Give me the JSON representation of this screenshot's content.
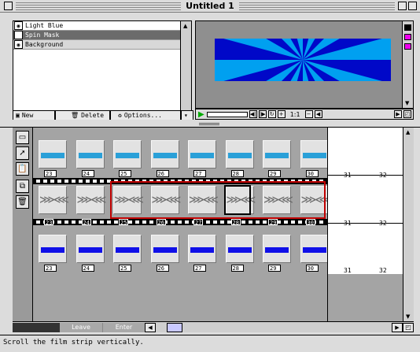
{
  "window": {
    "title": "Untitled 1"
  },
  "layers": {
    "items": [
      {
        "name": "Light Blue",
        "state": "normal"
      },
      {
        "name": "Spin Mask",
        "state": "selected"
      },
      {
        "name": "Background",
        "state": "alt"
      }
    ],
    "buttons": {
      "new": "New",
      "delete": "Delete",
      "options": "Options..."
    }
  },
  "preview": {
    "zoom": "1:1",
    "colors": {
      "bg": "#00a0f0",
      "ray": "#0008c8"
    }
  },
  "filmstrip": {
    "frame_numbers": [
      "23",
      "24",
      "25",
      "26",
      "27",
      "28",
      "29",
      "30"
    ],
    "extra_numbers": [
      "31",
      "32"
    ],
    "rows": [
      {
        "name": "light-blue",
        "color": "#2aa0d8"
      },
      {
        "name": "spin-mask",
        "color": "#808080"
      },
      {
        "name": "background",
        "color": "#1010e8"
      }
    ]
  },
  "scrollbar": {
    "leave": "Leave",
    "enter": "Enter"
  },
  "status": {
    "text": "Scroll the film strip vertically."
  }
}
